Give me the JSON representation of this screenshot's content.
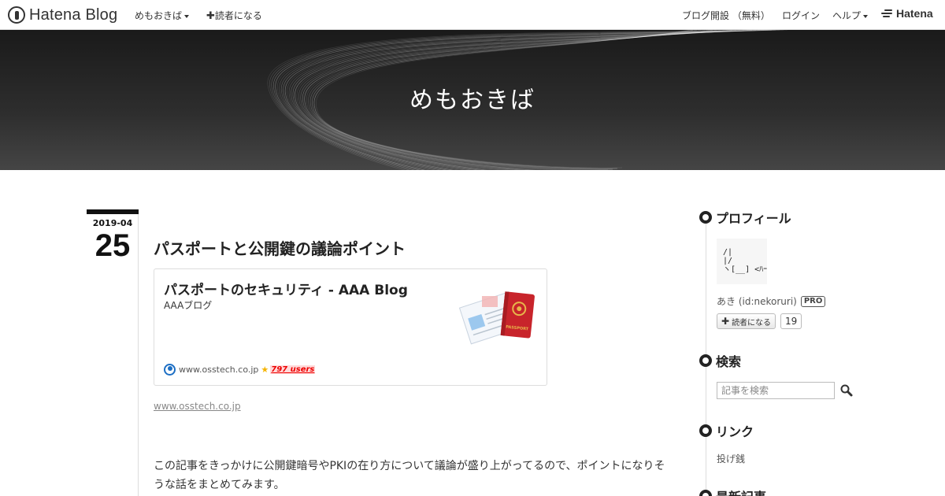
{
  "topbar": {
    "logo_text": "Hatena Blog",
    "blog_menu": "めもおきば",
    "subscribe": "読者になる",
    "open_blog": "ブログ開設 （無料）",
    "login": "ログイン",
    "help": "ヘルプ",
    "hatena": "Hatena"
  },
  "banner": {
    "title": "めもおきば"
  },
  "entry": {
    "date_ym": "2019-04",
    "date_day": "25",
    "title": "パスポートと公開鍵の議論ポイント",
    "embed": {
      "title": "パスポートのセキュリティ - AAA Blog",
      "site_name": "AAAブログ",
      "domain": "www.osstech.co.jp",
      "users": "797 users"
    },
    "link": "www.osstech.co.jp",
    "body": "この記事をきっかけに公開鍵暗号やPKIの在り方について議論が盛り上がってるので、ポイントになりそうな話をまとめてみます。"
  },
  "sidebar": {
    "profile": {
      "heading": "プロフィール",
      "avatar_text": " /|\n |/\n ヽ[__] <ﾊｰｲ",
      "name": "あき (id:nekoruri)",
      "badge": "PRO",
      "subscribe": "読者になる",
      "count": "19"
    },
    "search": {
      "heading": "検索",
      "placeholder": "記事を検索"
    },
    "links": {
      "heading": "リンク",
      "items": [
        "投げ銭"
      ]
    },
    "recent": {
      "heading": "最新記事"
    }
  }
}
